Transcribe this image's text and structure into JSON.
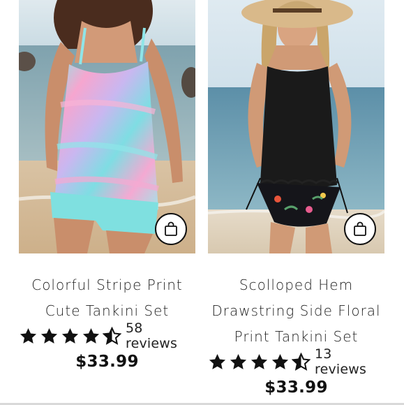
{
  "products": [
    {
      "title_line1": "Colorful Stripe Print",
      "title_line2": "Cute Tankini Set",
      "title_line3": "",
      "rating": 4.5,
      "reviews": "58 reviews",
      "price": "$33.99",
      "icon": "shopping-bag-icon"
    },
    {
      "title_line1": "Scolloped Hem",
      "title_line2": "Drawstring Side Floral",
      "title_line3": "Print Tankini Set",
      "rating": 4.5,
      "reviews": "13 reviews",
      "price": "$33.99",
      "icon": "shopping-bag-icon"
    }
  ],
  "colors": {
    "text": "#111111",
    "star": "#111111",
    "divider": "#d9d9d9"
  }
}
